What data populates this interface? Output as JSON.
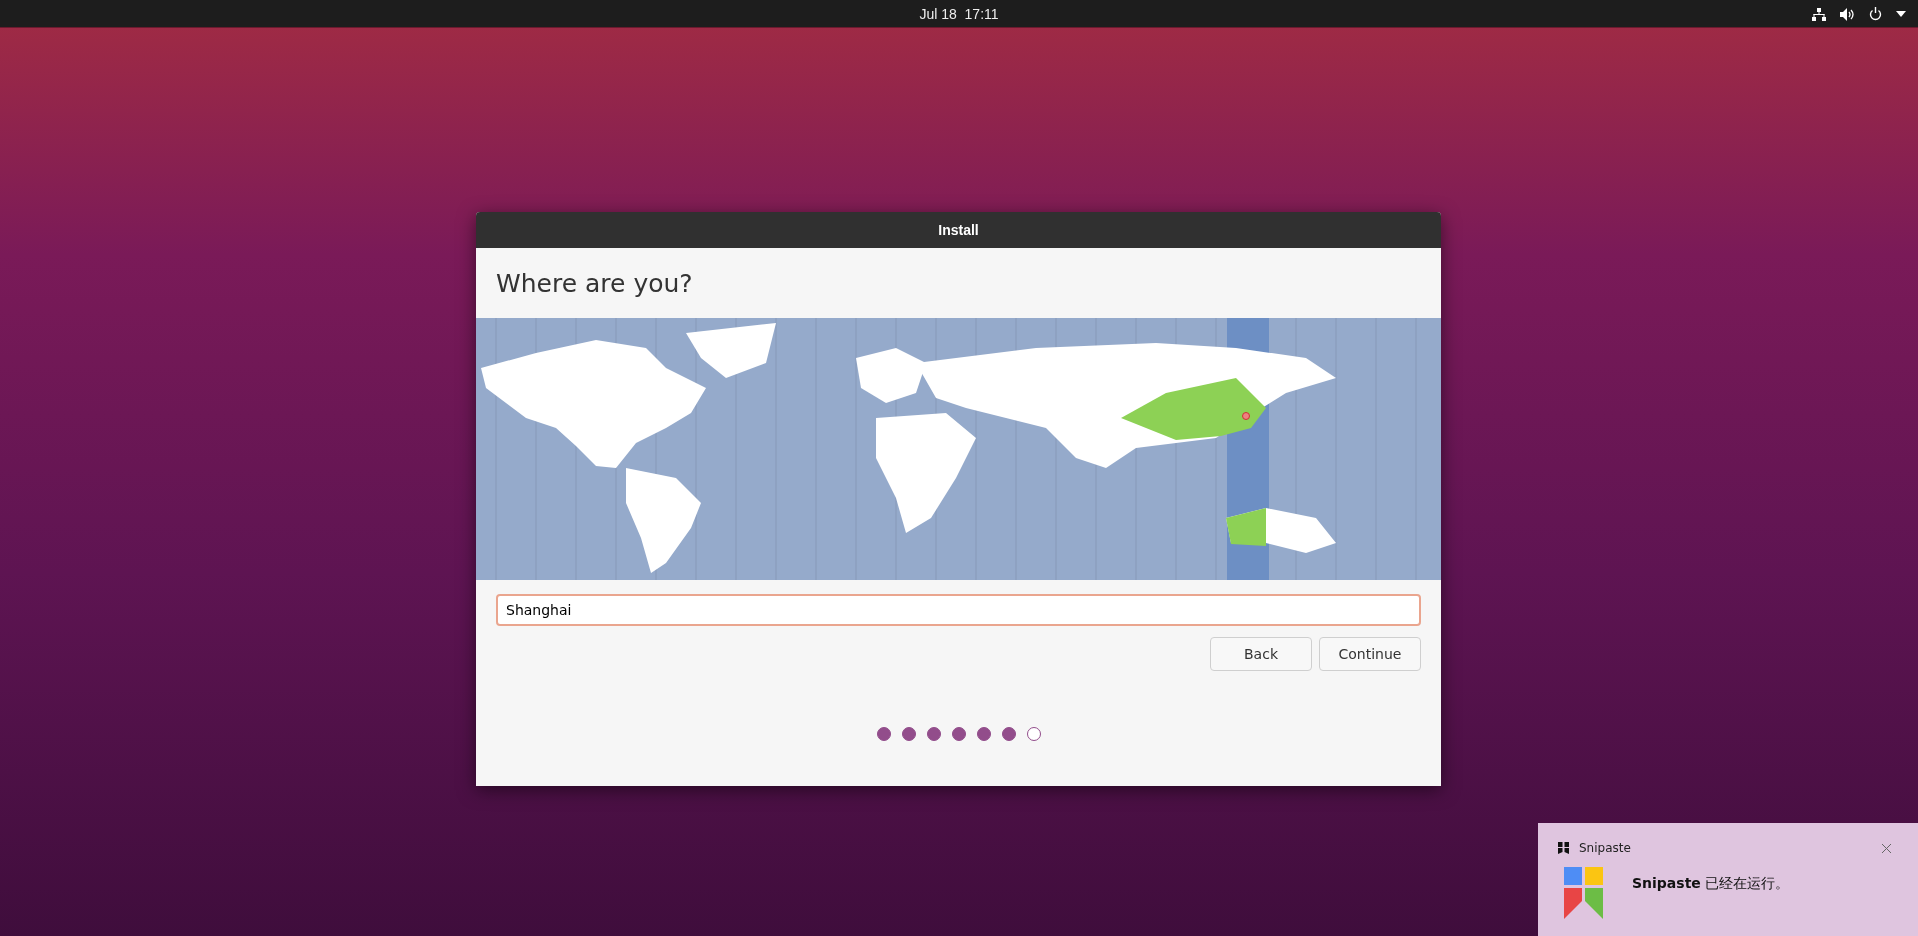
{
  "top_bar": {
    "clock": "Jul 18  17:11"
  },
  "window": {
    "title": "Install",
    "heading": "Where are you?",
    "location_field": {
      "value": "Shanghai",
      "focused": true
    },
    "buttons": [
      {
        "label": "Back"
      },
      {
        "label": "Continue"
      }
    ],
    "progress_steps": [
      {
        "completed": true
      },
      {
        "completed": true
      },
      {
        "completed": true
      },
      {
        "completed": true
      },
      {
        "completed": true
      },
      {
        "completed": true
      },
      {
        "completed": false
      }
    ]
  },
  "notification": {
    "app": "Snipaste",
    "message": "**Snipaste** 已经在运行。"
  }
}
